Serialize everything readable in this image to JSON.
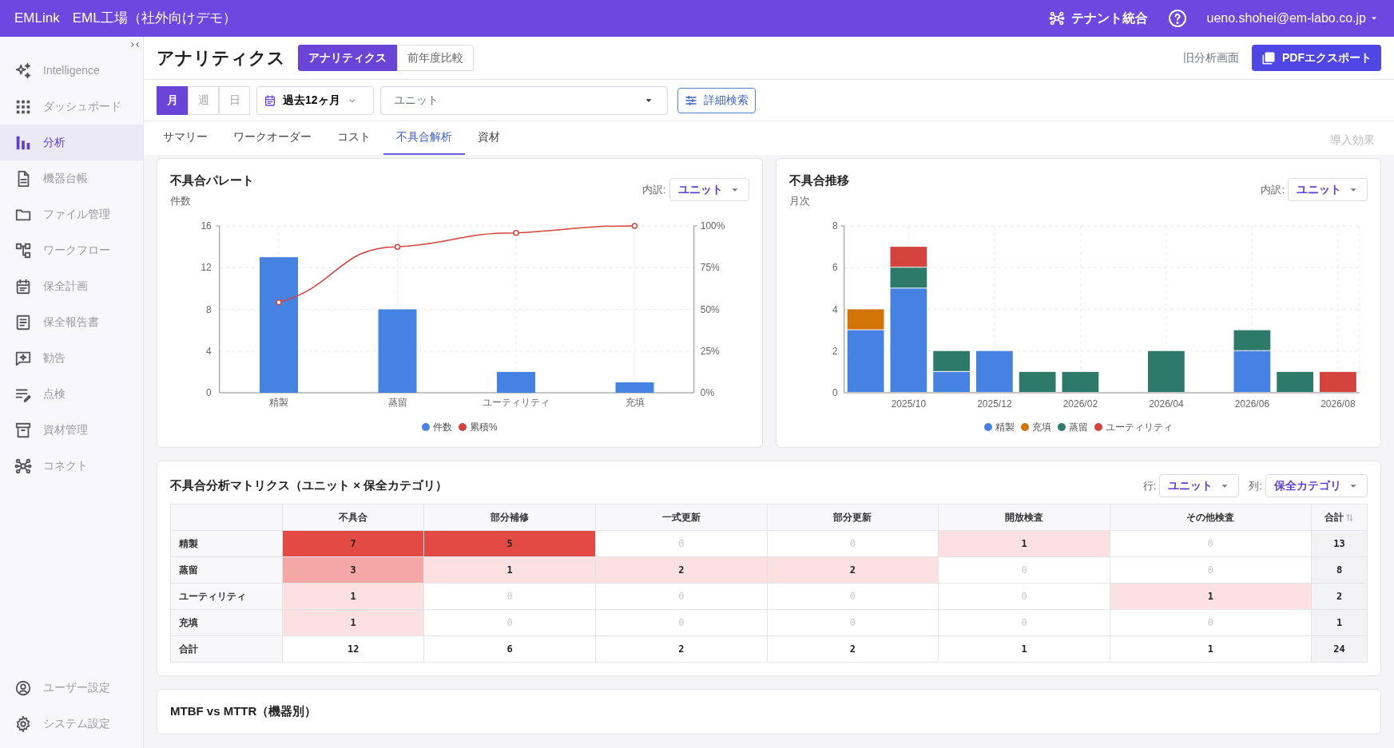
{
  "header": {
    "brand": "EMLink",
    "org": "EML工場（社外向けデモ）",
    "tenant": "テナント統合",
    "user": "ueno.shohei@em-labo.co.jp"
  },
  "sidebar": {
    "items": [
      {
        "label": "Intelligence",
        "kind": "sparkle",
        "selected": false
      },
      {
        "label": "ダッシュボード",
        "kind": "grid",
        "selected": false
      },
      {
        "label": "分析",
        "kind": "bars",
        "selected": true
      },
      {
        "label": "機器台帳",
        "kind": "document",
        "selected": false
      },
      {
        "label": "ファイル管理",
        "kind": "folder",
        "selected": false
      },
      {
        "label": "ワークフロー",
        "kind": "workflow",
        "selected": false
      },
      {
        "label": "保全計画",
        "kind": "calendar",
        "selected": false
      },
      {
        "label": "保全報告書",
        "kind": "report",
        "selected": false
      },
      {
        "label": "勧告",
        "kind": "chat",
        "selected": false
      },
      {
        "label": "点検",
        "kind": "checklist",
        "selected": false
      },
      {
        "label": "資材管理",
        "kind": "archive",
        "selected": false
      },
      {
        "label": "コネクト",
        "kind": "network",
        "selected": false
      }
    ],
    "footer_items": [
      {
        "label": "ユーザー設定",
        "kind": "user",
        "selected": false
      },
      {
        "label": "システム設定",
        "kind": "gear",
        "selected": false
      }
    ]
  },
  "page": {
    "title": "アナリティクス",
    "views": [
      {
        "label": "アナリティクス",
        "selected": true
      },
      {
        "label": "前年度比較",
        "selected": false
      }
    ],
    "legacy_link": "旧分析画面",
    "export_button": "PDFエクスポート"
  },
  "filters": {
    "periods": [
      {
        "label": "月",
        "selected": true
      },
      {
        "label": "週",
        "selected": false
      },
      {
        "label": "日",
        "selected": false
      }
    ],
    "range": "過去12ヶ月",
    "unit_placeholder": "ユニット",
    "advanced_button": "詳細検索"
  },
  "tabs": [
    {
      "label": "サマリー",
      "selected": false
    },
    {
      "label": "ワークオーダー",
      "selected": false
    },
    {
      "label": "コスト",
      "selected": false
    },
    {
      "label": "不具合解析",
      "selected": true
    },
    {
      "label": "資材",
      "selected": false
    }
  ],
  "tabs_right": "導入効果",
  "pareto": {
    "title": "不具合パレート",
    "subtitle": "件数",
    "breakdown_label": "内訳:",
    "breakdown_value": "ユニット",
    "chart_data": {
      "type": "bar",
      "grid": true,
      "categories": [
        "精製",
        "蒸留",
        "ユーティリティ",
        "充填"
      ],
      "ylim": [
        0,
        16
      ],
      "yticks": [
        0,
        4,
        8,
        12,
        16
      ],
      "y2lim": [
        0,
        100
      ],
      "y2ticks": [
        {
          "value": 0,
          "label": "0%"
        },
        {
          "value": 25,
          "label": "25%"
        },
        {
          "value": 50,
          "label": "50%"
        },
        {
          "value": 75,
          "label": "75%"
        },
        {
          "value": 100,
          "label": "100%"
        }
      ],
      "series": [
        {
          "name": "件数",
          "color": "#4682e2",
          "values": [
            13,
            8,
            2,
            1
          ]
        },
        {
          "name": "累積%",
          "color": "#d4433d",
          "type": "line",
          "axis": "y2",
          "marker": true,
          "values": [
            54.2,
            87.5,
            95.8,
            100
          ]
        }
      ]
    }
  },
  "trend": {
    "title": "不具合推移",
    "subtitle": "月次",
    "breakdown_label": "内訳:",
    "breakdown_value": "ユニット",
    "chart_data": {
      "type": "bar",
      "stacked": true,
      "grid": true,
      "categories": [
        null,
        "2025/10",
        null,
        "2025/12",
        null,
        "2026/02",
        null,
        "2026/04",
        null,
        "2026/06",
        null,
        "2026/08"
      ],
      "ylim": [
        0,
        8
      ],
      "yticks": [
        0,
        2,
        4,
        6,
        8
      ],
      "series": [
        {
          "name": "精製",
          "color": "#4682e2",
          "values": [
            3,
            5,
            1,
            2,
            0,
            0,
            0,
            0,
            0,
            2,
            0,
            0
          ]
        },
        {
          "name": "充填",
          "color": "#d27406",
          "values": [
            1,
            0,
            0,
            0,
            0,
            0,
            0,
            0,
            0,
            0,
            0,
            0
          ]
        },
        {
          "name": "蒸留",
          "color": "#2e7a6a",
          "values": [
            0,
            1,
            1,
            0,
            1,
            1,
            0,
            2,
            0,
            1,
            1,
            0
          ]
        },
        {
          "name": "ユーティリティ",
          "color": "#d4433d",
          "values": [
            0,
            1,
            0,
            0,
            0,
            0,
            0,
            0,
            0,
            0,
            0,
            1
          ]
        }
      ]
    }
  },
  "matrix": {
    "title": "不具合分析マトリクス（ユニット × 保全カテゴリ）",
    "row_label": "行:",
    "row_value": "ユニット",
    "col_label": "列:",
    "col_value": "保全カテゴリ",
    "columns": [
      "不具合",
      "部分補修",
      "一式更新",
      "部分更新",
      "開放検査",
      "その他検査",
      "合計"
    ],
    "rows": [
      {
        "name": "精製",
        "cells": [
          "7",
          "5",
          "0",
          "0",
          "1",
          "0"
        ],
        "total": "13"
      },
      {
        "name": "蒸留",
        "cells": [
          "3",
          "1",
          "2",
          "2",
          "0",
          "0"
        ],
        "total": "8"
      },
      {
        "name": "ユーティリティ",
        "cells": [
          "1",
          "0",
          "0",
          "0",
          "0",
          "1"
        ],
        "total": "2"
      },
      {
        "name": "充填",
        "cells": [
          "1",
          "0",
          "0",
          "0",
          "0",
          "0"
        ],
        "total": "1"
      }
    ],
    "totals": {
      "name": "合計",
      "cells": [
        "12",
        "6",
        "2",
        "2",
        "1",
        "1"
      ],
      "total": "24"
    }
  },
  "mtbf": {
    "title": "MTBF vs MTTR（機器別）"
  }
}
